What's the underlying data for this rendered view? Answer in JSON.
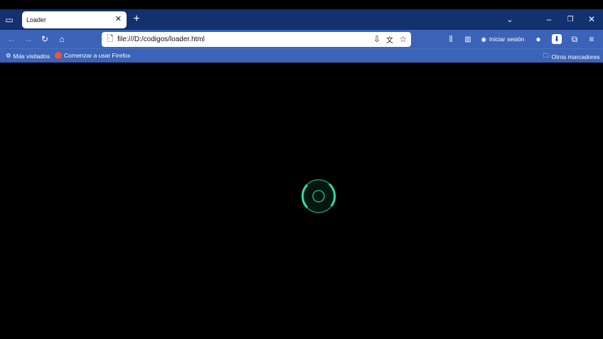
{
  "tab": {
    "title": "Loader"
  },
  "toolbar": {
    "url": "file:///D:/codigos/loader.html",
    "signin_label": "Iniciar sesión"
  },
  "bookmarks": {
    "items": [
      {
        "label": "Más visitados"
      },
      {
        "label": "Comenzar a usar Firefox"
      }
    ],
    "other": "Otros marcadores"
  },
  "loader": {
    "accent": "#2de0a0"
  }
}
